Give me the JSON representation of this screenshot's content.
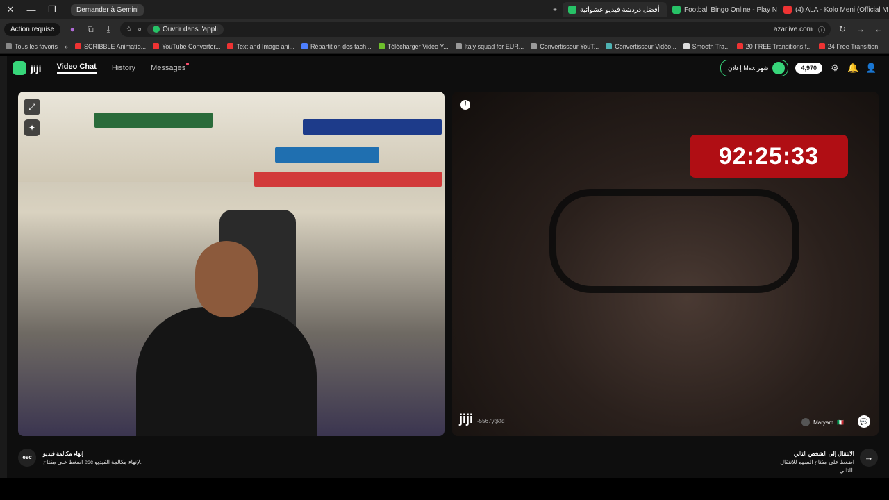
{
  "browser": {
    "tabs": [
      {
        "title": "(4) ALA - Kolo Meni (Official M",
        "color": "#e33"
      },
      {
        "title": "Football Bingo Online - Play N",
        "color": "#27c267"
      },
      {
        "title": "أفضل دردشة فيديو عشوائية",
        "color": "#27c267",
        "active": true
      }
    ],
    "gemini_label": "Demander à Gemini",
    "new_tab": "+",
    "window_controls": [
      "✕",
      "—",
      "❐"
    ]
  },
  "toolbar": {
    "action_label": "Action requise",
    "open_app": "Ouvrir dans l'appli",
    "url": "azarlive.com"
  },
  "bookmarks": {
    "all_label": "Tous les favoris",
    "items": [
      "SCRIBBLE Animatio...",
      "YouTube Converter...",
      "Text and Image ani...",
      "Répartition des tach...",
      "Télécharger Vidéo Y...",
      "Italy squad for EUR...",
      "Convertisseur YouT...",
      "Convertisseur Vidéo...",
      "Smooth Tra...",
      "20 FREE Transitions f...",
      "24 Free Transition"
    ]
  },
  "site": {
    "logo": "jiji",
    "nav": {
      "video_chat": "Video Chat",
      "history": "History",
      "messages": "Messages"
    },
    "max_pill": "إعلان Max شهر",
    "coins": "4,970"
  },
  "remote": {
    "timer": "92:25:33",
    "watermark": "jiji",
    "user_id": "-5567ygkfd",
    "username": "Maryam",
    "flag": "🇮🇹",
    "accent": "#b00e14"
  },
  "footer": {
    "esc_key": "esc",
    "esc_title": "إنهاء مكالمة فيديو",
    "esc_sub": "اضغط على مفتاح esc لإنهاء مكالمة الفيديو.",
    "next_title": "الانتقال إلى الشخص التالي",
    "next_sub": "اضغط على مفتاح السهم للانتقال للتالي."
  }
}
